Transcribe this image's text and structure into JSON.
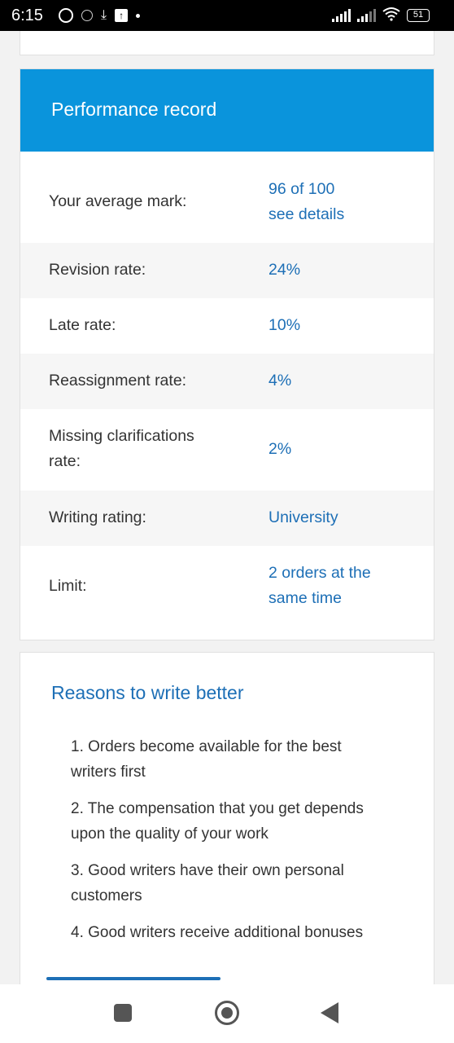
{
  "status_bar": {
    "time": "6:15",
    "battery": "51"
  },
  "performance": {
    "title": "Performance record",
    "rows": [
      {
        "label": "Your average mark:",
        "value": "96 of 100",
        "link": "see details"
      },
      {
        "label": "Revision rate:",
        "value": "24%"
      },
      {
        "label": "Late rate:",
        "value": "10%"
      },
      {
        "label": "Reassignment rate:",
        "value": "4%"
      },
      {
        "label_line1": "Missing clarifications",
        "label_line2": "rate:",
        "value": "2%"
      },
      {
        "label": "Writing rating:",
        "value": "University"
      },
      {
        "label": "Limit:",
        "value_line1": "2 orders at the",
        "value_line2": "same time"
      }
    ]
  },
  "reasons": {
    "title": "Reasons to write better",
    "items": [
      {
        "line1": "1. Orders become available for the best",
        "line2": "writers first"
      },
      {
        "line1": "2. The compensation that you get depends",
        "line2": "upon the quality of your work"
      },
      {
        "line1": "3. Good writers have their own personal",
        "line2": "customers"
      },
      {
        "line1": "4. Good writers receive additional bonuses"
      }
    ]
  }
}
